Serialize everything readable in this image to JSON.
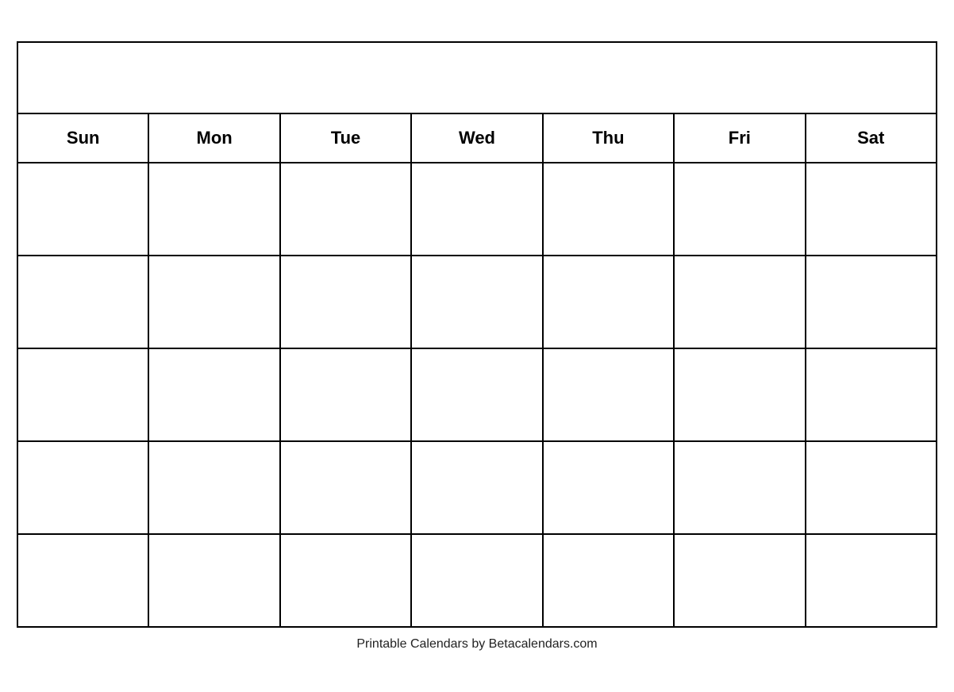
{
  "calendar": {
    "title": "",
    "days": [
      "Sun",
      "Mon",
      "Tue",
      "Wed",
      "Thu",
      "Fri",
      "Sat"
    ],
    "weeks": 5
  },
  "footer": {
    "text": "Printable Calendars by Betacalendars.com"
  }
}
